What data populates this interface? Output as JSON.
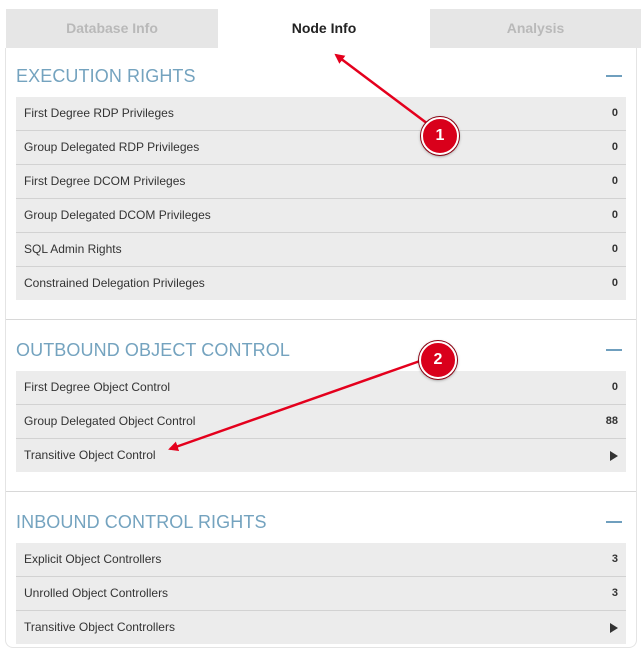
{
  "tabs": [
    {
      "label": "Database Info",
      "active": false
    },
    {
      "label": "Node Info",
      "active": true
    },
    {
      "label": "Analysis",
      "active": false
    }
  ],
  "sections": [
    {
      "title": "EXECUTION RIGHTS",
      "rows": [
        {
          "label": "First Degree RDP Privileges",
          "value": "0"
        },
        {
          "label": "Group Delegated RDP Privileges",
          "value": "0"
        },
        {
          "label": "First Degree DCOM Privileges",
          "value": "0"
        },
        {
          "label": "Group Delegated DCOM Privileges",
          "value": "0"
        },
        {
          "label": "SQL Admin Rights",
          "value": "0"
        },
        {
          "label": "Constrained Delegation Privileges",
          "value": "0"
        }
      ]
    },
    {
      "title": "OUTBOUND OBJECT CONTROL",
      "rows": [
        {
          "label": "First Degree Object Control",
          "value": "0"
        },
        {
          "label": "Group Delegated Object Control",
          "value": "88"
        },
        {
          "label": "Transitive Object Control",
          "icon": "play-icon"
        }
      ]
    },
    {
      "title": "INBOUND CONTROL RIGHTS",
      "rows": [
        {
          "label": "Explicit Object Controllers",
          "value": "3"
        },
        {
          "label": "Unrolled Object Controllers",
          "value": "3"
        },
        {
          "label": "Transitive Object Controllers",
          "icon": "play-icon"
        }
      ]
    }
  ],
  "annotations": [
    {
      "label": "1"
    },
    {
      "label": "2"
    }
  ],
  "colors": {
    "section_title": "#74a3bf",
    "row_background": "#ececec",
    "annotation_red": "#d9001b",
    "inactive_tab": "#e6e6e6"
  }
}
